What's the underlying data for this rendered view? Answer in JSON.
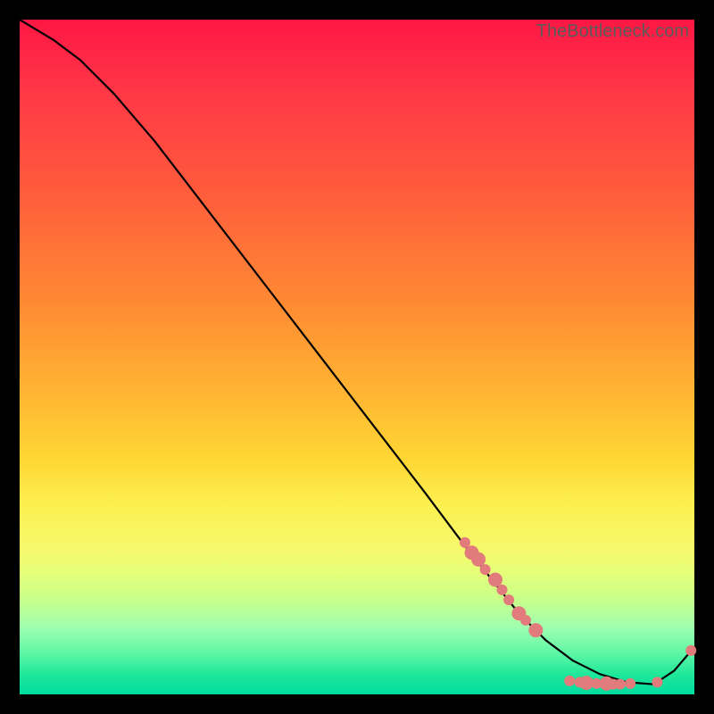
{
  "watermark": "TheBottleneck.com",
  "chart_data": {
    "type": "line",
    "title": "",
    "xlabel": "",
    "ylabel": "",
    "xlim": [
      0,
      100
    ],
    "ylim": [
      0,
      100
    ],
    "curve": {
      "x": [
        0,
        5,
        9,
        14,
        20,
        30,
        40,
        50,
        60,
        66,
        70,
        74,
        78,
        82,
        86,
        90,
        94,
        97,
        100
      ],
      "y": [
        100,
        97,
        94,
        89,
        82,
        69,
        56,
        43,
        30,
        22,
        17,
        12,
        8,
        5,
        3,
        1.8,
        1.5,
        3.5,
        7
      ]
    },
    "markers": {
      "color": "#e27b7b",
      "points": [
        {
          "x": 66.0,
          "y": 22.5,
          "r": 6
        },
        {
          "x": 67.0,
          "y": 21.0,
          "r": 8
        },
        {
          "x": 68.0,
          "y": 20.0,
          "r": 8
        },
        {
          "x": 69.0,
          "y": 18.5,
          "r": 6
        },
        {
          "x": 70.5,
          "y": 17.0,
          "r": 8
        },
        {
          "x": 71.5,
          "y": 15.5,
          "r": 6
        },
        {
          "x": 72.5,
          "y": 14.0,
          "r": 6
        },
        {
          "x": 74.0,
          "y": 12.0,
          "r": 8
        },
        {
          "x": 75.0,
          "y": 11.0,
          "r": 6
        },
        {
          "x": 76.5,
          "y": 9.5,
          "r": 8
        },
        {
          "x": 81.5,
          "y": 2.0,
          "r": 6
        },
        {
          "x": 83.0,
          "y": 1.8,
          "r": 6
        },
        {
          "x": 84.0,
          "y": 1.7,
          "r": 8
        },
        {
          "x": 85.5,
          "y": 1.6,
          "r": 6
        },
        {
          "x": 87.0,
          "y": 1.6,
          "r": 8
        },
        {
          "x": 88.0,
          "y": 1.5,
          "r": 6
        },
        {
          "x": 89.0,
          "y": 1.5,
          "r": 6
        },
        {
          "x": 90.5,
          "y": 1.6,
          "r": 6
        },
        {
          "x": 94.5,
          "y": 1.8,
          "r": 6
        },
        {
          "x": 99.5,
          "y": 6.5,
          "r": 6
        }
      ]
    }
  }
}
